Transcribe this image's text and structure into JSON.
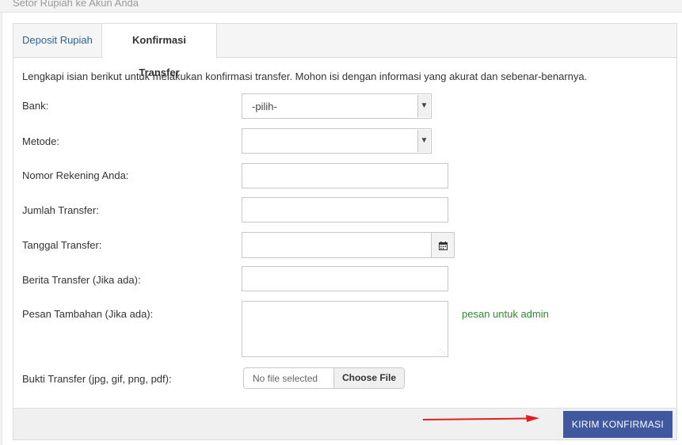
{
  "header": {
    "title": "Setor Rupiah ke Akun Anda"
  },
  "tabs": [
    {
      "label": "Deposit Rupiah",
      "active": false
    },
    {
      "label": "Konfirmasi Transfer",
      "active": true
    }
  ],
  "form": {
    "intro": "Lengkapi isian berikut untuk melakukan konfirmasi transfer. Mohon isi dengan informasi yang akurat dan sebenar-benarnya.",
    "bank": {
      "label": "Bank:",
      "selected": "-pilih-"
    },
    "metode": {
      "label": "Metode:",
      "selected": ""
    },
    "nomor_rekening": {
      "label": "Nomor Rekening Anda:",
      "value": ""
    },
    "jumlah_transfer": {
      "label": "Jumlah Transfer:",
      "value": ""
    },
    "tanggal_transfer": {
      "label": "Tanggal Transfer:",
      "value": ""
    },
    "berita_transfer": {
      "label": "Berita Transfer (Jika ada):",
      "value": ""
    },
    "pesan_tambahan": {
      "label": "Pesan Tambahan (Jika ada):",
      "value": "",
      "hint": "pesan untuk admin"
    },
    "bukti_transfer": {
      "label": "Bukti Transfer (jpg, gif, png, pdf):",
      "file_status": "No file selected",
      "choose_label": "Choose File"
    }
  },
  "footer": {
    "submit_label": "KIRIM KONFIRMASI"
  },
  "colors": {
    "accent": "#3f58a0",
    "hint": "#2e8b2e",
    "link": "#2a6496",
    "annotation_arrow": "#e02020"
  },
  "icons": {
    "select_arrow": "chevron-down-icon",
    "calendar": "calendar-icon",
    "resize": "resize-grip-icon",
    "annotation": "red-arrow-icon"
  }
}
